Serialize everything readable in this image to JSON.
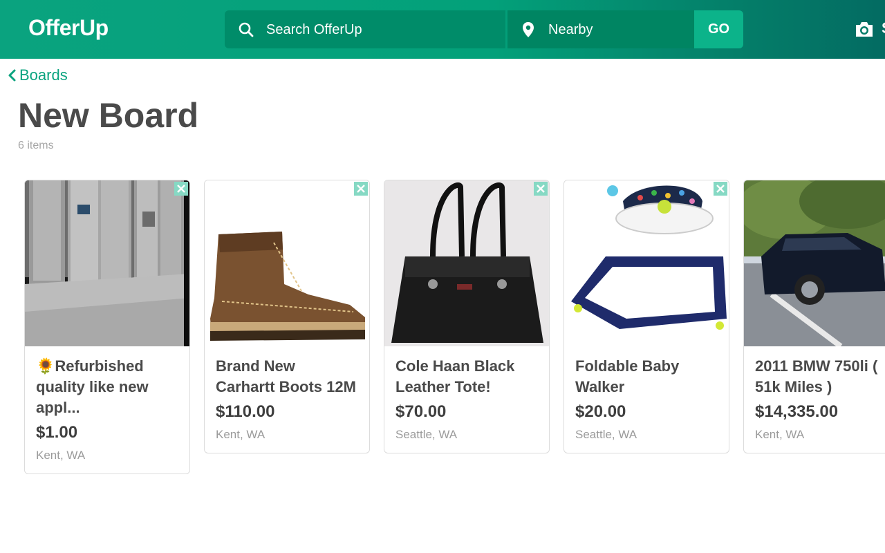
{
  "header": {
    "logo": "OfferUp",
    "search_placeholder": "Search OfferUp",
    "location_label": "Nearby",
    "go_label": "GO",
    "cut_text": "S",
    "icons": [
      "search-icon",
      "location-pin-icon",
      "camera-icon"
    ]
  },
  "breadcrumb": {
    "label": "Boards"
  },
  "board": {
    "title": "New Board",
    "count": "6 items"
  },
  "colors": {
    "brand": "#0aa37f",
    "remove_btn": "#86d9c4"
  },
  "items": [
    {
      "title": "🌻Refurbished quality like new appl...",
      "price": "$1.00",
      "location": "Kent, WA"
    },
    {
      "title": "Brand New Carhartt Boots 12M",
      "price": "$110.00",
      "location": "Kent, WA"
    },
    {
      "title": "Cole Haan Black Leather Tote!",
      "price": "$70.00",
      "location": "Seattle, WA"
    },
    {
      "title": "Foldable Baby Walker",
      "price": "$20.00",
      "location": "Seattle, WA"
    },
    {
      "title": "2011 BMW 750li ( 51k Miles )",
      "price": "$14,335.00",
      "location": "Kent, WA"
    }
  ]
}
